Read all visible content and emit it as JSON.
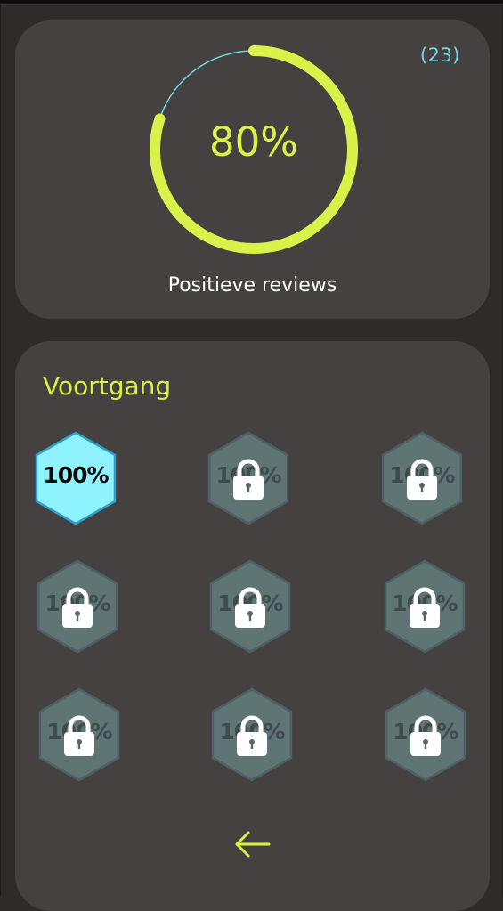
{
  "reviews": {
    "count_label": "(23)",
    "percent_label": "80%",
    "percent_value": 80,
    "caption": "Positieve reviews"
  },
  "progress": {
    "title": "Voortgang",
    "badges": [
      {
        "label": "100%",
        "locked": false
      },
      {
        "label": "100%",
        "locked": true
      },
      {
        "label": "100%",
        "locked": true
      },
      {
        "label": "100%",
        "locked": true
      },
      {
        "label": "100%",
        "locked": true
      },
      {
        "label": "100%",
        "locked": true
      },
      {
        "label": "100%",
        "locked": true
      },
      {
        "label": "100%",
        "locked": true
      },
      {
        "label": "100%",
        "locked": true
      }
    ]
  },
  "icons": {
    "badge_lock": "lock-icon",
    "back": "arrow-left-icon"
  },
  "colors": {
    "accent": "#d8f24a",
    "cyan": "#6fd9e8",
    "unlocked_fill": "#8ff3ff",
    "locked_fill": "#5f7574",
    "card_bg": "#454141",
    "page_bg": "#2f2b2b"
  }
}
